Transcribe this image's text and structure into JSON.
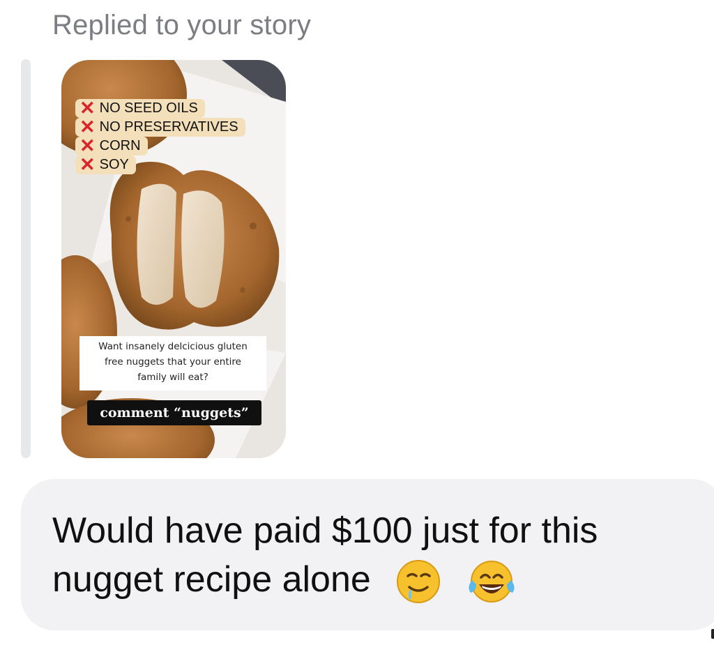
{
  "header": {
    "reply_label": "Replied to your story"
  },
  "story": {
    "checklist": [
      {
        "icon": "x-mark-icon",
        "label": "NO SEED OILS"
      },
      {
        "icon": "x-mark-icon",
        "label": "NO PRESERVATIVES"
      },
      {
        "icon": "x-mark-icon",
        "label": "CORN"
      },
      {
        "icon": "x-mark-icon",
        "label": "SOY"
      }
    ],
    "caption_lines": [
      "Want insanely delcicious gluten",
      "free nuggets that your entire",
      "family will eat?"
    ],
    "cta": "comment “nuggets”"
  },
  "message": {
    "line1": "Would have paid $100 just for this",
    "line2": "nugget recipe alone",
    "emojis": [
      "drooling-face-emoji",
      "tears-of-joy-emoji"
    ]
  },
  "colors": {
    "bubble": "#f2f2f4",
    "quote_bar": "#e7e8ea",
    "label_gray": "#7b7d82",
    "x_red": "#d8242b",
    "checklist_bg": "#f3dfb9"
  }
}
